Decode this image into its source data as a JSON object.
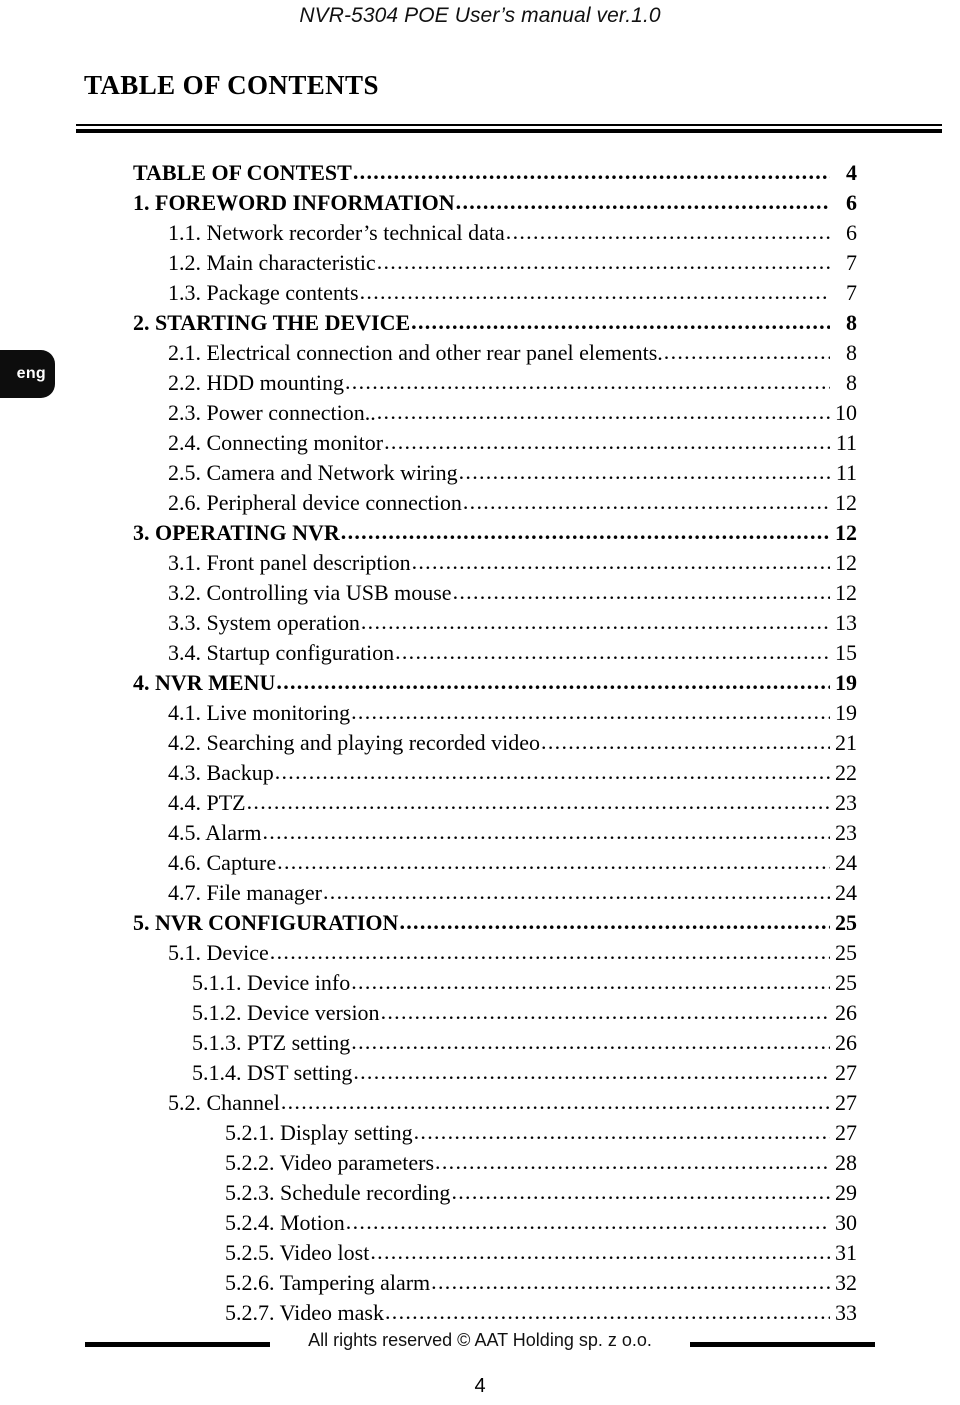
{
  "header": {
    "running_title": "NVR-5304 POE User’s manual ver.1.0"
  },
  "lang_tab": {
    "label": "eng"
  },
  "page_title": "TABLE OF CONTENTS",
  "toc": {
    "leader_char": ".",
    "entries": [
      {
        "level": 1,
        "label": "TABLE OF CONTEST",
        "page": "4"
      },
      {
        "level": 1,
        "label": "1. FOREWORD INFORMATION",
        "page": "6"
      },
      {
        "level": 2,
        "label": "1.1. Network recorder’s technical data",
        "page": "6"
      },
      {
        "level": 2,
        "label": "1.2. Main characteristic",
        "page": "7"
      },
      {
        "level": 2,
        "label": "1.3. Package contents",
        "page": "7"
      },
      {
        "level": 1,
        "label": "2. STARTING THE DEVICE",
        "page": "8"
      },
      {
        "level": 2,
        "label": "2.1. Electrical connection and other rear panel elements.",
        "page": "8"
      },
      {
        "level": 2,
        "label": "2.2. HDD mounting",
        "page": "8"
      },
      {
        "level": 2,
        "label": "2.3. Power connection..",
        "page": "10"
      },
      {
        "level": 2,
        "label": "2.4. Connecting monitor",
        "page": "11"
      },
      {
        "level": 2,
        "label": "2.5. Camera and Network wiring",
        "page": "11"
      },
      {
        "level": 2,
        "label": "2.6. Peripheral device connection",
        "page": "12"
      },
      {
        "level": 1,
        "label": "3. OPERATING NVR",
        "page": "12"
      },
      {
        "level": 2,
        "label": "3.1. Front panel description",
        "page": "12"
      },
      {
        "level": 2,
        "label": "3.2. Controlling via USB mouse",
        "page": "12"
      },
      {
        "level": 2,
        "label": "3.3. System operation",
        "page": "13"
      },
      {
        "level": 2,
        "label": "3.4. Startup configuration",
        "page": "15"
      },
      {
        "level": 1,
        "label": "4. NVR MENU",
        "page": "19"
      },
      {
        "level": 2,
        "label": "4.1. Live monitoring",
        "page": "19"
      },
      {
        "level": 2,
        "label": "4.2. Searching and playing recorded video",
        "page": "21"
      },
      {
        "level": 2,
        "label": "4.3. Backup",
        "page": "22"
      },
      {
        "level": 2,
        "label": "4.4. PTZ",
        "page": "23"
      },
      {
        "level": 2,
        "label": "4.5. Alarm",
        "page": "23"
      },
      {
        "level": 2,
        "label": "4.6. Capture",
        "page": "24"
      },
      {
        "level": 2,
        "label": "4.7. File manager",
        "page": "24"
      },
      {
        "level": 1,
        "label": "5. NVR CONFIGURATION",
        "page": "25"
      },
      {
        "level": 2,
        "label": "5.1. Device",
        "page": "25"
      },
      {
        "level": 3,
        "label": "5.1.1. Device info",
        "page": "25"
      },
      {
        "level": 3,
        "label": "5.1.2. Device version",
        "page": "26"
      },
      {
        "level": 3,
        "label": "5.1.3. PTZ setting",
        "page": "26"
      },
      {
        "level": 3,
        "label": "5.1.4. DST setting",
        "page": "27"
      },
      {
        "level": 2,
        "label": "5.2. Channel",
        "page": "27"
      },
      {
        "level": 4,
        "label": "5.2.1. Display setting",
        "page": "27"
      },
      {
        "level": 4,
        "label": "5.2.2. Video parameters",
        "page": "28"
      },
      {
        "level": 4,
        "label": "5.2.3. Schedule recording",
        "page": "29"
      },
      {
        "level": 4,
        "label": "5.2.4. Motion",
        "page": "30"
      },
      {
        "level": 4,
        "label": "5.2.5. Video lost",
        "page": "31"
      },
      {
        "level": 4,
        "label": "5.2.6. Tampering alarm",
        "page": "32"
      },
      {
        "level": 4,
        "label": "5.2.7. Video mask",
        "page": "33"
      }
    ]
  },
  "footer": {
    "copyright": "All rights reserved © AAT Holding sp. z o.o.",
    "page_number": "4"
  }
}
